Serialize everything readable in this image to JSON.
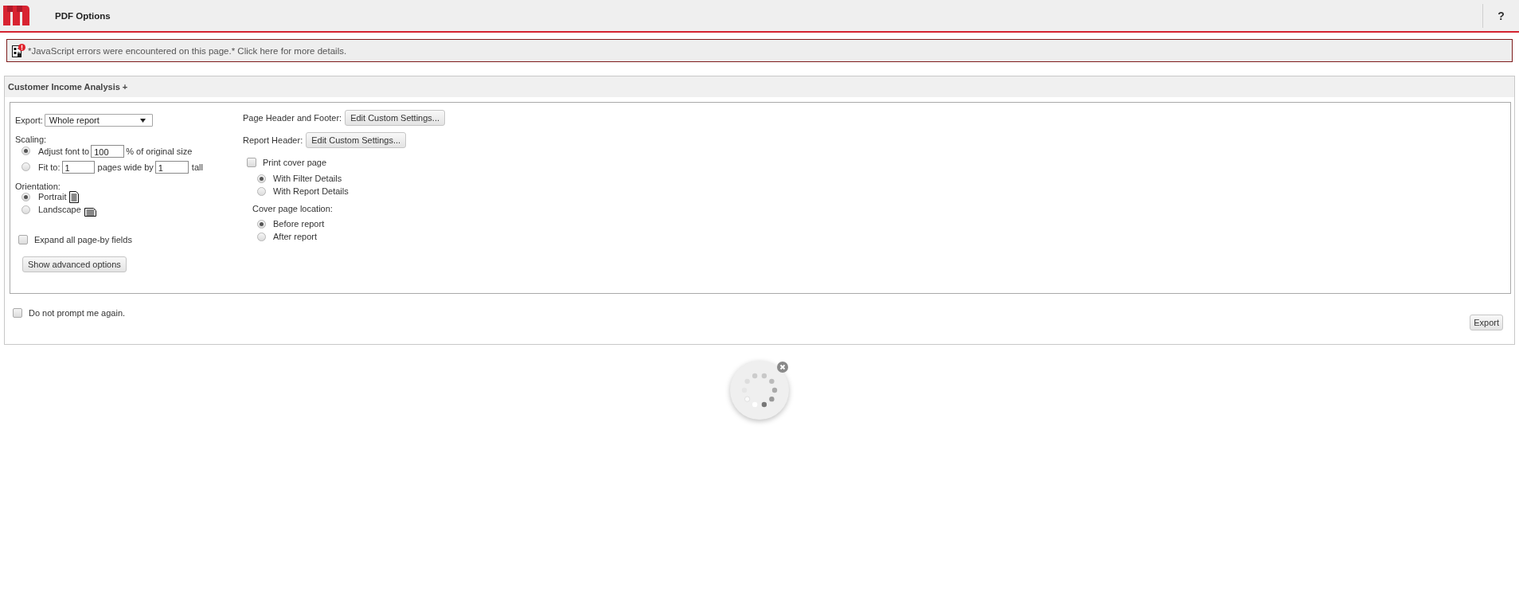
{
  "header": {
    "title": "PDF Options",
    "help": "?"
  },
  "alert": {
    "text": "*JavaScript errors were encountered on this page.* Click here for more details."
  },
  "panel": {
    "title": "Customer Income Analysis +",
    "export": {
      "label": "Export:",
      "value": "Whole report"
    },
    "scaling": {
      "label": "Scaling:",
      "options": [
        {
          "kind": "adjust",
          "selected": true,
          "label": "Adjust font to",
          "value": "100",
          "suffix": "% of original size"
        },
        {
          "kind": "fit",
          "selected": false,
          "label": "Fit to:",
          "wide": "1",
          "middle": "pages wide by",
          "tall": "1",
          "suffix": "tall"
        }
      ]
    },
    "orientation": {
      "label": "Orientation:",
      "options": [
        {
          "kind": "portrait",
          "label": "Portrait",
          "selected": true
        },
        {
          "kind": "landscape",
          "label": "Landscape",
          "selected": false
        }
      ]
    },
    "expand_page_by": {
      "label": "Expand all page-by fields",
      "checked": false
    },
    "advanced_button": "Show advanced options",
    "header_settings": [
      {
        "label": "Page Header and Footer:",
        "button": "Edit Custom Settings..."
      },
      {
        "label": "Report Header:",
        "button": "Edit Custom Settings..."
      }
    ],
    "cover_page": {
      "label": "Print cover page",
      "checked": false,
      "details": [
        {
          "label": "With Filter Details",
          "selected": true
        },
        {
          "label": "With Report Details",
          "selected": false
        }
      ],
      "location_label": "Cover page location:",
      "locations": [
        {
          "label": "Before report",
          "selected": true
        },
        {
          "label": "After report",
          "selected": false
        }
      ]
    },
    "do_not_prompt": {
      "label": "Do not prompt me again.",
      "checked": false
    },
    "export_button": "Export"
  }
}
